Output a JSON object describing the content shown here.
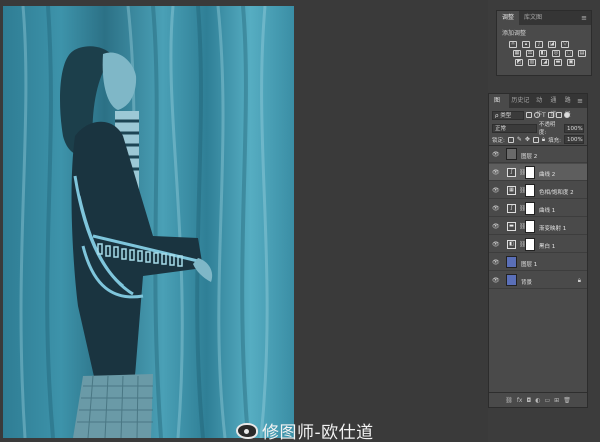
{
  "adjustments_panel": {
    "tabs": [
      "调整",
      "库文图"
    ],
    "menu": "≡",
    "subtitle": "添加调整",
    "icons": [
      "brightness-contrast-icon",
      "levels-icon",
      "curves-icon",
      "exposure-icon",
      "vibrance-icon",
      "hue-saturation-icon",
      "color-balance-icon",
      "black-white-icon",
      "photo-filter-icon",
      "channel-mixer-icon",
      "color-lookup-icon",
      "invert-icon",
      "posterize-icon",
      "threshold-icon",
      "gradient-map-icon",
      "selective-color-icon"
    ]
  },
  "layers_panel": {
    "tabs": [
      "图层",
      "历史记录",
      "动作",
      "通道",
      "路径"
    ],
    "menu": "≡",
    "filter_label": "ρ 类型",
    "blend_mode": "正常",
    "opacity_label": "不透明度:",
    "opacity_value": "100%",
    "lock_label": "锁定:",
    "fill_label": "填充:",
    "fill_value": "100%",
    "layers": [
      {
        "name": "图层 2",
        "type": "pixel",
        "selected": false
      },
      {
        "name": "曲线 2",
        "type": "adjustment",
        "selected": true
      },
      {
        "name": "色相/饱和度 2",
        "type": "adjustment",
        "selected": false
      },
      {
        "name": "曲线 1",
        "type": "adjustment",
        "selected": false
      },
      {
        "name": "渐变映射 1",
        "type": "adjustment",
        "selected": false
      },
      {
        "name": "黑白 1",
        "type": "adjustment",
        "selected": false
      },
      {
        "name": "图层 1",
        "type": "pixel",
        "selected": false
      },
      {
        "name": "背景",
        "type": "background",
        "selected": false
      }
    ],
    "footer_icons": [
      "link-icon",
      "fx-icon",
      "mask-icon",
      "adjustment-icon",
      "folder-icon",
      "new-layer-icon",
      "trash-icon"
    ]
  },
  "watermark": {
    "text": "修图师-欧仕道"
  }
}
